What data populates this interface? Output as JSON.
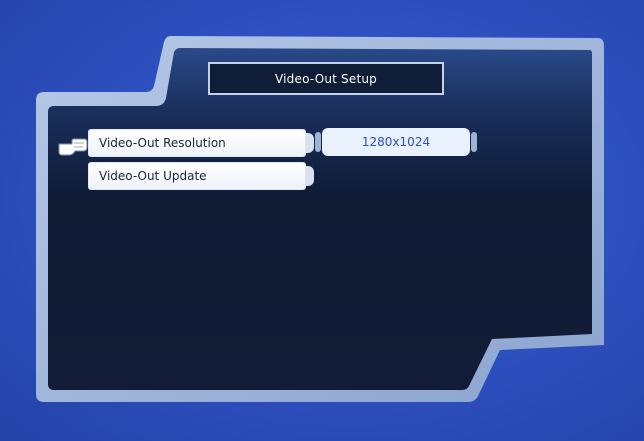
{
  "screen": {
    "title": "Video-Out Setup"
  },
  "menu": {
    "items": [
      {
        "label": "Video-Out Resolution"
      },
      {
        "label": "Video-Out Update"
      }
    ]
  },
  "value": {
    "resolution": "1280x1024"
  },
  "icons": {
    "pointer": "hand-pointer-icon"
  },
  "colors": {
    "background": "#2f52c4",
    "panel_border": "#9cb6dd",
    "panel_fill": "#111b35",
    "title_fill": "#0f1d36",
    "button_fill": "#ffffff",
    "value_text": "#2f4fc0"
  }
}
